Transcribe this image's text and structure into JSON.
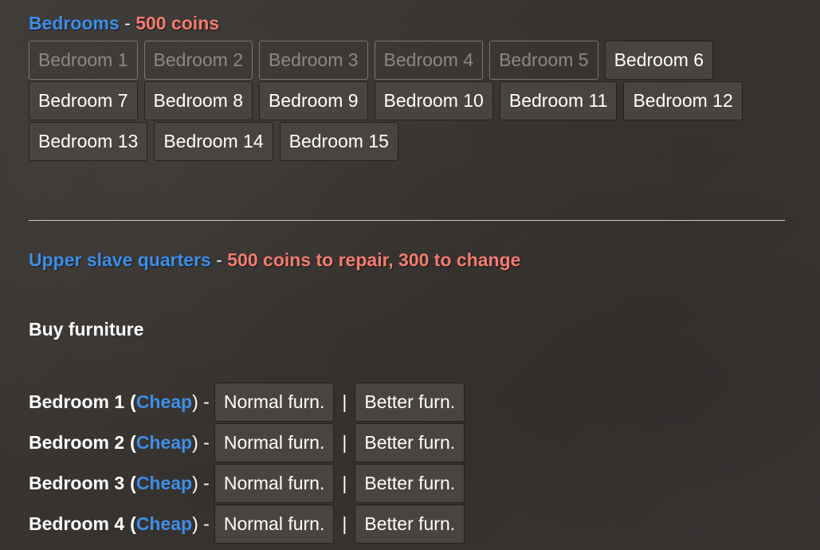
{
  "bedrooms_section": {
    "title": "Bedrooms",
    "separator": "-",
    "cost": "500 coins",
    "buttons": [
      {
        "label": "Bedroom 1",
        "disabled": true
      },
      {
        "label": "Bedroom 2",
        "disabled": true
      },
      {
        "label": "Bedroom 3",
        "disabled": true
      },
      {
        "label": "Bedroom 4",
        "disabled": true
      },
      {
        "label": "Bedroom 5",
        "disabled": true
      },
      {
        "label": "Bedroom 6",
        "disabled": false
      },
      {
        "label": "Bedroom 7",
        "disabled": false
      },
      {
        "label": "Bedroom 8",
        "disabled": false
      },
      {
        "label": "Bedroom 9",
        "disabled": false
      },
      {
        "label": "Bedroom 10",
        "disabled": false
      },
      {
        "label": "Bedroom 11",
        "disabled": false
      },
      {
        "label": "Bedroom 12",
        "disabled": false
      },
      {
        "label": "Bedroom 13",
        "disabled": false
      },
      {
        "label": "Bedroom 14",
        "disabled": false
      },
      {
        "label": "Bedroom 15",
        "disabled": false
      }
    ]
  },
  "slave_quarters": {
    "title": "Upper slave quarters",
    "separator": "-",
    "cost": "500 coins to repair, 300 to change"
  },
  "furniture": {
    "heading": "Buy furniture",
    "rows": [
      {
        "room": "Bedroom 1",
        "quality": "Cheap",
        "normal": "Normal furn.",
        "better": "Better furn."
      },
      {
        "room": "Bedroom 2",
        "quality": "Cheap",
        "normal": "Normal furn.",
        "better": "Better furn."
      },
      {
        "room": "Bedroom 3",
        "quality": "Cheap",
        "normal": "Normal furn.",
        "better": "Better furn."
      },
      {
        "room": "Bedroom 4",
        "quality": "Cheap",
        "normal": "Normal furn.",
        "better": "Better furn."
      }
    ],
    "pipe": "|",
    "open_paren": "(",
    "close_paren_dash": ") -"
  },
  "colors": {
    "link": "#3d8ee8",
    "cost": "#f47c70",
    "button_bg": "#4a4441",
    "background": "#3a3634"
  }
}
